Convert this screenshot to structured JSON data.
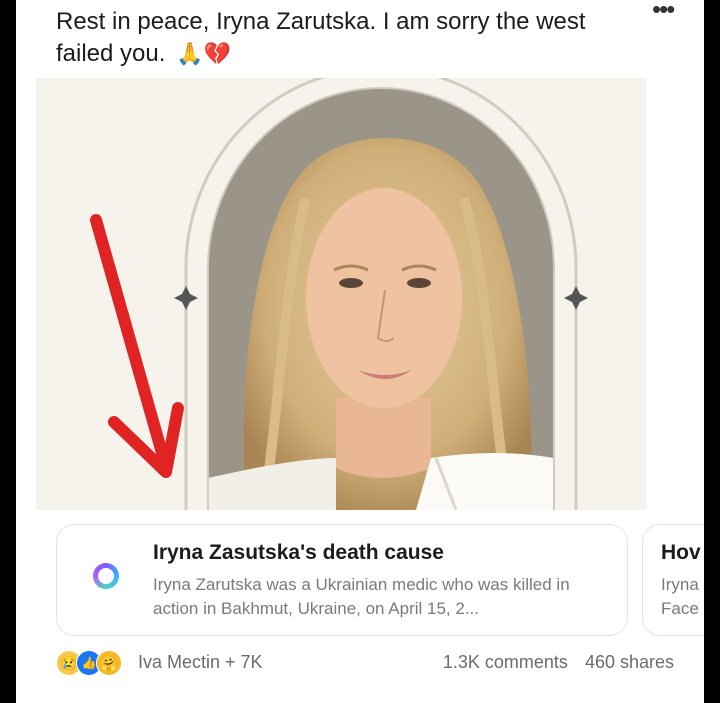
{
  "post": {
    "text": "Rest in peace, Iryna Zarutska. I am sorry the west failed you.",
    "emoji": "🙏💔"
  },
  "icons": {
    "more": "more-icon",
    "audio": "audio-icon",
    "link_ring": "ring-icon",
    "arrow": "red-arrow"
  },
  "audio": {
    "glyph": "♪)"
  },
  "link_card": {
    "title": "Iryna Zasutska's death cause",
    "description": "Iryna Zarutska was a Ukrainian medic who was killed in action in Bakhmut, Ukraine, on April 15, 2..."
  },
  "link_card_2": {
    "title": "Hov",
    "description_line1": "Iryna",
    "description_line2": "Face"
  },
  "footer": {
    "reaction_names": "Iva Mectin + 7K",
    "comments": "1.3K comments",
    "shares": "460 shares"
  },
  "colors": {
    "arrow": "#e02424",
    "card_bg": "#f6f3ec",
    "accent_ring": "#7b5cff"
  }
}
